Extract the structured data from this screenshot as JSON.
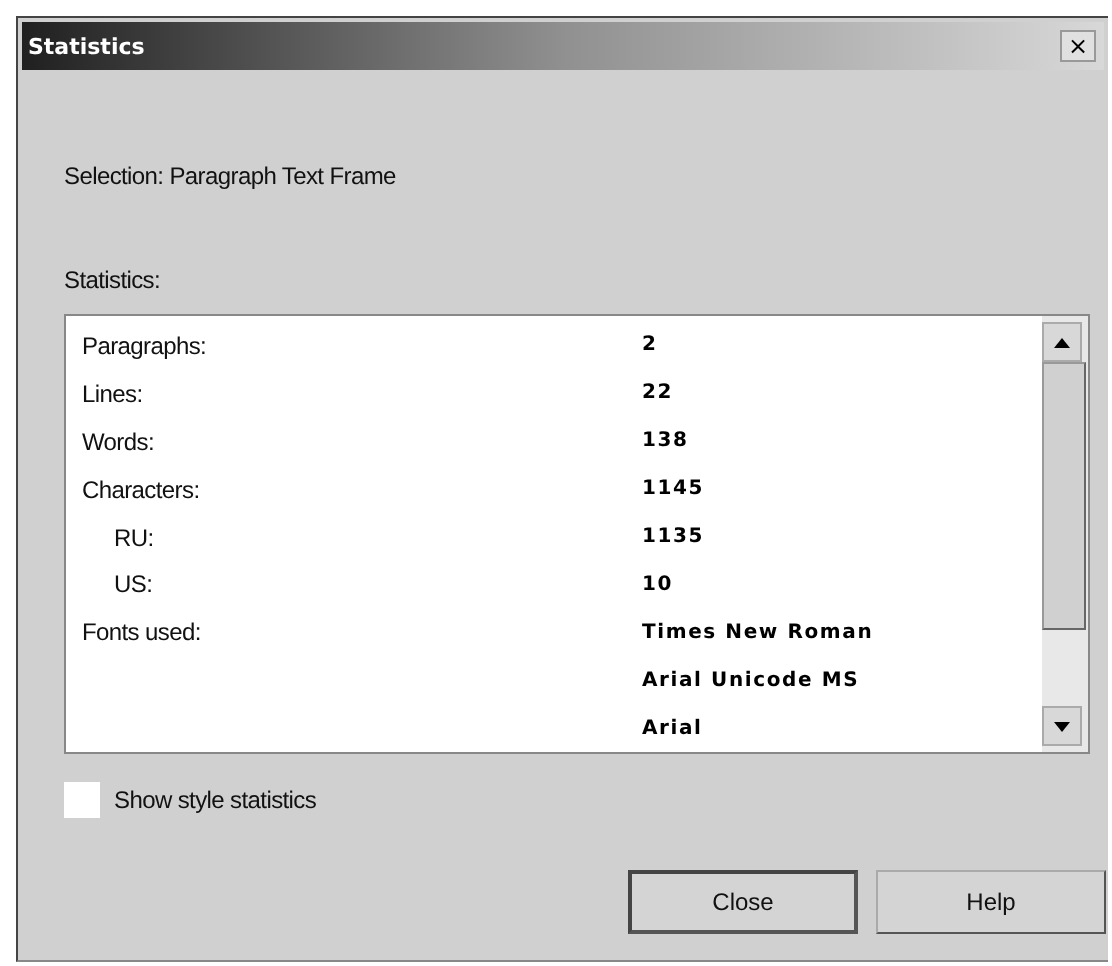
{
  "window": {
    "title": "Statistics",
    "close_glyph": "×"
  },
  "selection": "Selection: Paragraph Text Frame",
  "statistics_label": "Statistics:",
  "rows": [
    {
      "label": "Paragraphs:",
      "values": [
        "2"
      ]
    },
    {
      "label": "Lines:",
      "values": [
        "22"
      ]
    },
    {
      "label": "Words:",
      "values": [
        "138"
      ]
    },
    {
      "label": "Characters:",
      "values": [
        "1145"
      ],
      "children": [
        {
          "label": "RU:",
          "values": [
            "1135"
          ]
        },
        {
          "label": "US:",
          "values": [
            "10"
          ]
        }
      ]
    },
    {
      "label": "Fonts used:",
      "values": [
        "Times New Roman",
        "Arial Unicode MS",
        "Arial"
      ]
    }
  ],
  "show_style_statistics": {
    "label": "Show style statistics",
    "checked": false
  },
  "buttons": [
    {
      "label": "Close",
      "default": true
    },
    {
      "label": "Help",
      "default": false
    }
  ]
}
